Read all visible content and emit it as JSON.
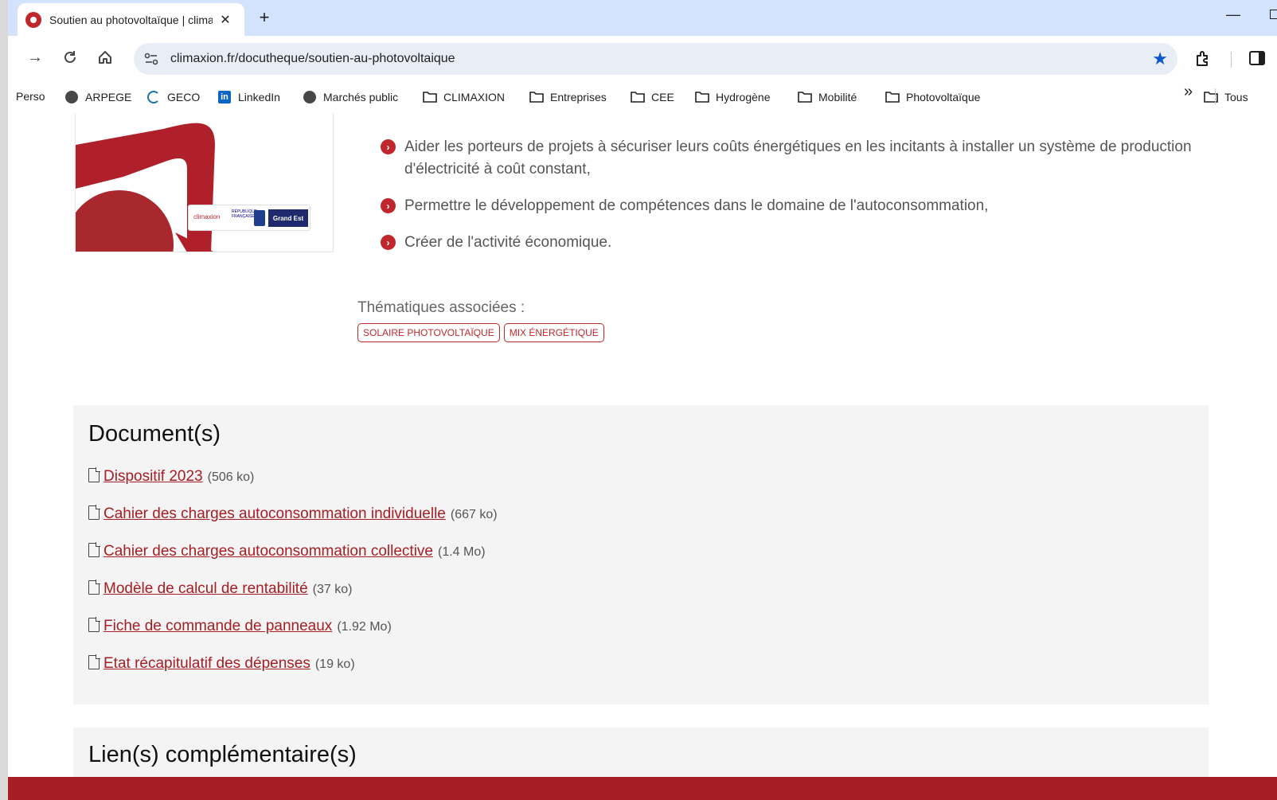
{
  "browser": {
    "tab_title": "Soutien au photovoltaïque | climaxion",
    "tab_close": "✕",
    "new_tab": "+",
    "url": "climaxion.fr/docutheque/soutien-au-photovoltaique",
    "colors": {
      "tabstrip": "#d3e3fd",
      "omnibox": "#e9eef6",
      "star": "#0b57d0"
    },
    "bookmarks": [
      {
        "label": "Perso",
        "icon": "none"
      },
      {
        "label": "ARPEGE",
        "icon": "globe-icon"
      },
      {
        "label": "GECO",
        "icon": "geco-icon"
      },
      {
        "label": "LinkedIn",
        "icon": "linkedin-icon"
      },
      {
        "label": "Marchés public",
        "icon": "globe-icon"
      },
      {
        "label": "CLIMAXION",
        "icon": "folder-icon"
      },
      {
        "label": "Entreprises",
        "icon": "folder-icon"
      },
      {
        "label": "CEE",
        "icon": "folder-icon"
      },
      {
        "label": "Hydrogène",
        "icon": "folder-icon"
      },
      {
        "label": "Mobilité",
        "icon": "folder-icon"
      },
      {
        "label": "Photovoltaïque",
        "icon": "folder-icon"
      }
    ],
    "more_bookmarks": "»",
    "all_bookmarks": "Tous"
  },
  "page": {
    "accent": "#c0272d",
    "hero_logos": {
      "climaxion": "climaxion",
      "grand_est": "Grand Est",
      "republique": "RÉPUBLIQUE FRANÇAISE"
    },
    "bullets": [
      "Aider les porteurs de projets à sécuriser leurs coûts énergétiques en les incitants à installer un système de production d'électricité à coût constant,",
      "Permettre le développement de compétences dans le domaine de l'autoconsommation,",
      "Créer de l'activité économique."
    ],
    "thematiques_label": "Thématiques associées :",
    "tags": [
      "SOLAIRE PHOTOVOLTAÏQUE",
      "MIX ÉNERGÉTIQUE"
    ],
    "documents_title": "Document(s)",
    "documents": [
      {
        "label": "Dispositif 2023",
        "size": "(506 ko)"
      },
      {
        "label": "Cahier des charges autoconsommation individuelle",
        "size": "(667 ko)"
      },
      {
        "label": "Cahier des charges autoconsommation collective",
        "size": "(1.4 Mo)"
      },
      {
        "label": "Modèle de calcul de rentabilité",
        "size": "(37 ko)"
      },
      {
        "label": "Fiche de commande de panneaux",
        "size": "(1.92 Mo)"
      },
      {
        "label": "Etat récapitulatif des dépenses",
        "size": "(19 ko)"
      }
    ],
    "links_title": "Lien(s) complémentaire(s)"
  }
}
